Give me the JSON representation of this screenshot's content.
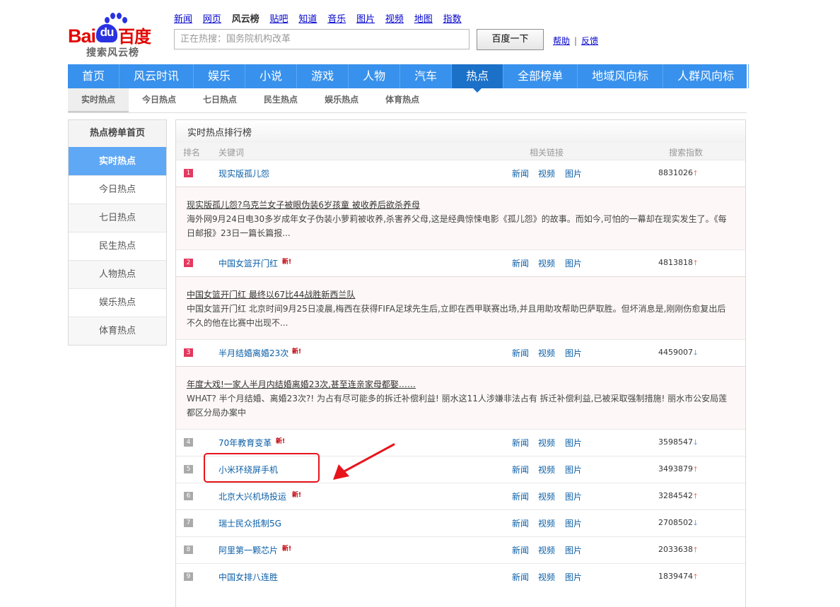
{
  "logo": {
    "brand_text": "Baidu百度",
    "sub_text": "搜索风云榜"
  },
  "topnav": [
    {
      "label": "新闻"
    },
    {
      "label": "网页"
    },
    {
      "label": "风云榜",
      "current": true
    },
    {
      "label": "贴吧"
    },
    {
      "label": "知道"
    },
    {
      "label": "音乐"
    },
    {
      "label": "图片"
    },
    {
      "label": "视频"
    },
    {
      "label": "地图"
    },
    {
      "label": "指数"
    }
  ],
  "search": {
    "placeholder": "正在热搜：国务院机构改革",
    "button_label": "百度一下",
    "help_label": "帮助",
    "feedback_label": "反馈",
    "separator": "|"
  },
  "mainnav": [
    {
      "label": "首页"
    },
    {
      "label": "风云时讯"
    },
    {
      "label": "娱乐"
    },
    {
      "label": "小说"
    },
    {
      "label": "游戏"
    },
    {
      "label": "人物"
    },
    {
      "label": "汽车"
    },
    {
      "label": "热点",
      "active": true
    },
    {
      "label": "全部榜单"
    },
    {
      "label": "地域风向标"
    },
    {
      "label": "人群风向标"
    }
  ],
  "subnav": [
    {
      "label": "实时热点",
      "active": true
    },
    {
      "label": "今日热点"
    },
    {
      "label": "七日热点"
    },
    {
      "label": "民生热点"
    },
    {
      "label": "娱乐热点"
    },
    {
      "label": "体育热点"
    }
  ],
  "sidebar": {
    "title": "热点榜单首页",
    "items": [
      {
        "label": "实时热点",
        "active": true
      },
      {
        "label": "今日热点"
      },
      {
        "label": "七日热点"
      },
      {
        "label": "民生热点"
      },
      {
        "label": "人物热点"
      },
      {
        "label": "娱乐热点"
      },
      {
        "label": "体育热点"
      }
    ]
  },
  "ranking": {
    "title": "实时热点排行榜",
    "columns": {
      "rank": "排名",
      "keyword": "关键词",
      "links": "相关链接",
      "index": "搜索指数"
    },
    "link_labels": {
      "news": "新闻",
      "video": "视频",
      "image": "图片"
    },
    "new_badge": "新!",
    "rows": [
      {
        "rank": "1",
        "keyword": "现实版孤儿怨",
        "is_new": false,
        "index": "8831026",
        "trend": "up",
        "detail": {
          "title": "现实版孤儿怨?乌克兰女子被眼伪装6岁孩童 被收养后欲杀养母",
          "summary": "海外网9月24日电30多岁成年女子伪装小萝莉被收养,杀害养父母,这是经典惊悚电影《孤儿怨》的故事。而如今,可怕的一幕却在现实发生了。《每日邮报》23日一篇长篇报..."
        }
      },
      {
        "rank": "2",
        "keyword": "中国女篮开门红",
        "is_new": true,
        "index": "4813818",
        "trend": "up",
        "detail": {
          "title": "中国女篮开门红 最终以67比44战胜新西兰队",
          "summary": "中国女篮开门红 北京时间9月25日凌晨,梅西在获得FIFA足球先生后,立即在西甲联赛出场,并且用助攻帮助巴萨取胜。但坏消息是,刚刚伤愈复出后不久的他在比赛中出现不..."
        }
      },
      {
        "rank": "3",
        "keyword": "半月结婚离婚23次",
        "is_new": true,
        "index": "4459007",
        "trend": "down",
        "detail": {
          "title": "年度大戏!一家人半月内结婚离婚23次,甚至连亲家母都娶……",
          "summary": "WHAT? 半个月结婚、离婚23次?! 为占有尽可能多的拆迁补偿利益! 丽水这11人涉嫌非法占有 拆迁补偿利益,已被采取强制措施! 丽水市公安局莲都区分局办案中"
        }
      },
      {
        "rank": "4",
        "keyword": "70年教育变革",
        "is_new": true,
        "index": "3598547",
        "trend": "down"
      },
      {
        "rank": "5",
        "keyword": "小米环绕屏手机",
        "is_new": false,
        "index": "3493879",
        "trend": "up"
      },
      {
        "rank": "6",
        "keyword": "北京大兴机场投运",
        "is_new": true,
        "index": "3284542",
        "trend": "up"
      },
      {
        "rank": "7",
        "keyword": "瑞士民众抵制5G",
        "is_new": false,
        "index": "2708502",
        "trend": "down"
      },
      {
        "rank": "8",
        "keyword": "阿里第一颗芯片",
        "is_new": true,
        "index": "2033638",
        "trend": "up"
      },
      {
        "rank": "9",
        "keyword": "中国女排八连胜",
        "is_new": false,
        "index": "1839474",
        "trend": "up"
      }
    ]
  },
  "colors": {
    "nav_blue": "#3891ec",
    "nav_active": "#1b70c8",
    "link": "#0b5fa8",
    "annotation_red": "#e8141b",
    "up_arrow": "#e63a1d",
    "down_arrow": "#2f70d6"
  },
  "icons": {
    "trend_up": "up-arrow-icon",
    "trend_down": "down-arrow-icon",
    "annotation": "red-pointer-arrow-icon"
  }
}
